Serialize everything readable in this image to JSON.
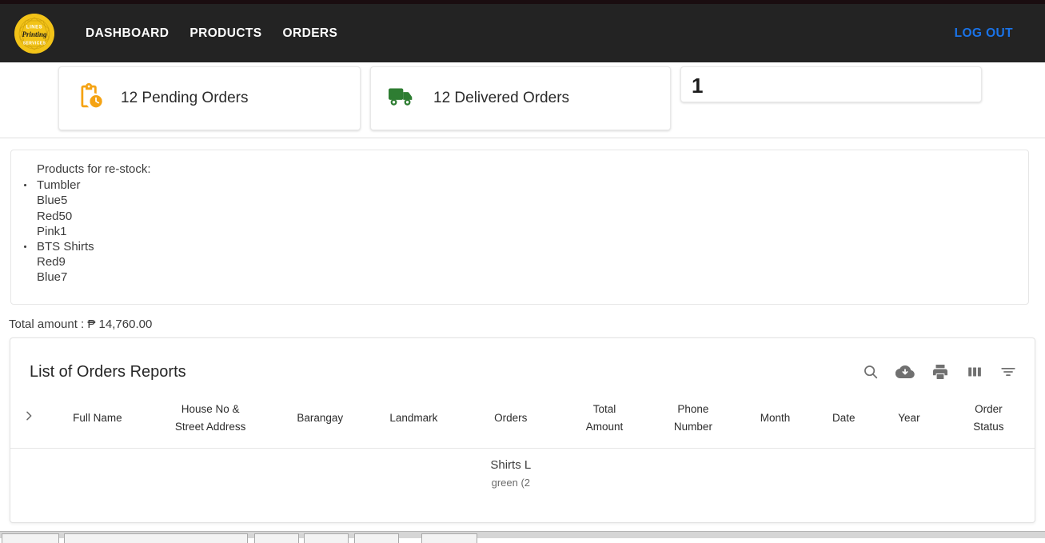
{
  "navbar": {
    "logo": {
      "name": "lines-printing-services-logo",
      "line1": "LINES",
      "line2": "Printing",
      "line3": "SERVICES"
    },
    "links": [
      {
        "id": "dashboard",
        "label": "DASHBOARD"
      },
      {
        "id": "products",
        "label": "PRODUCTS"
      },
      {
        "id": "orders",
        "label": "ORDERS"
      }
    ],
    "logout_label": "LOG OUT",
    "colors": {
      "background": "#232323",
      "link": "#ffffff",
      "logout": "#1a73e8",
      "logo_bg": "#f2c318"
    }
  },
  "stats": {
    "pending": {
      "label": "12 Pending Orders",
      "icon": "pending-clipboard-clock-icon",
      "color": "#f5a313"
    },
    "delivered": {
      "label": "12 Delivered Orders",
      "icon": "delivery-truck-icon",
      "color": "#2e7d32"
    },
    "count_card": {
      "value": "1"
    }
  },
  "restock": {
    "title": "Products for re-stock:",
    "items": [
      {
        "text": "Tumbler",
        "bulleted": true
      },
      {
        "text": "Blue5",
        "bulleted": false
      },
      {
        "text": "Red50",
        "bulleted": false
      },
      {
        "text": "Pink1",
        "bulleted": false
      },
      {
        "text": "BTS Shirts",
        "bulleted": true
      },
      {
        "text": "Red9",
        "bulleted": false
      },
      {
        "text": "Blue7",
        "bulleted": false
      }
    ]
  },
  "summary": {
    "total_amount_label": "Total amount : ₱ 14,760.00"
  },
  "orders_table": {
    "title": "List of Orders Reports",
    "toolbar_icons": [
      {
        "id": "search",
        "name": "search-icon"
      },
      {
        "id": "download",
        "name": "cloud-download-icon"
      },
      {
        "id": "print",
        "name": "print-icon"
      },
      {
        "id": "columns",
        "name": "view-columns-icon"
      },
      {
        "id": "filter",
        "name": "filter-list-icon"
      }
    ],
    "columns": [
      {
        "id": "expand",
        "label": ""
      },
      {
        "id": "full_name",
        "label": "Full Name"
      },
      {
        "id": "address",
        "label": "House No &\nStreet Address"
      },
      {
        "id": "barangay",
        "label": "Barangay"
      },
      {
        "id": "landmark",
        "label": "Landmark"
      },
      {
        "id": "orders",
        "label": "Orders"
      },
      {
        "id": "total_amount",
        "label": "Total\nAmount"
      },
      {
        "id": "phone_number",
        "label": "Phone\nNumber"
      },
      {
        "id": "month",
        "label": "Month"
      },
      {
        "id": "date",
        "label": "Date"
      },
      {
        "id": "year",
        "label": "Year"
      },
      {
        "id": "order_status",
        "label": "Order\nStatus"
      }
    ],
    "rows": [
      {
        "full_name": "",
        "address": "",
        "barangay": "",
        "landmark": "",
        "orders": "Shirts L",
        "orders_sub": "green (2",
        "total_amount": "",
        "phone_number": "",
        "month": "",
        "date": "",
        "year": "",
        "order_status": ""
      }
    ]
  }
}
